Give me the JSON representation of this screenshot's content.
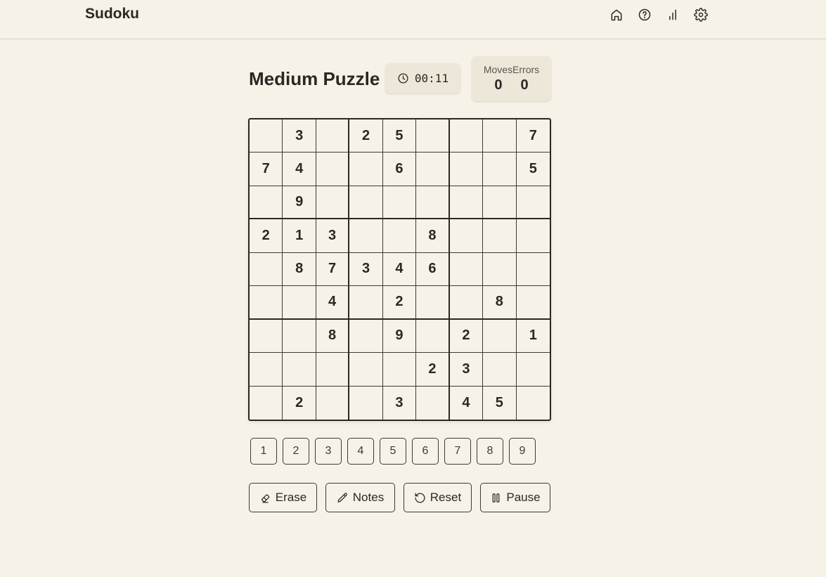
{
  "app": {
    "title": "Sudoku"
  },
  "nav": {
    "icons": [
      "home-icon",
      "help-icon",
      "stats-icon",
      "settings-icon"
    ]
  },
  "puzzle": {
    "title": "Medium Puzzle",
    "timer": "00:11",
    "moves_label": "Moves",
    "errors_label": "Errors",
    "moves": "0",
    "errors": "0"
  },
  "board": [
    [
      "",
      "3",
      "",
      "2",
      "5",
      "",
      "",
      "",
      "7"
    ],
    [
      "7",
      "4",
      "",
      "",
      "6",
      "",
      "",
      "",
      "5"
    ],
    [
      "",
      "9",
      "",
      "",
      "",
      "",
      "",
      "",
      ""
    ],
    [
      "2",
      "1",
      "3",
      "",
      "",
      "8",
      "",
      "",
      ""
    ],
    [
      "",
      "8",
      "7",
      "3",
      "4",
      "6",
      "",
      "",
      ""
    ],
    [
      "",
      "",
      "4",
      "",
      "2",
      "",
      "",
      "8",
      ""
    ],
    [
      "",
      "",
      "8",
      "",
      "9",
      "",
      "2",
      "",
      "1"
    ],
    [
      "",
      "",
      "",
      "",
      "",
      "2",
      "3",
      "",
      ""
    ],
    [
      "",
      "2",
      "",
      "",
      "3",
      "",
      "4",
      "5",
      ""
    ]
  ],
  "numpad": [
    "1",
    "2",
    "3",
    "4",
    "5",
    "6",
    "7",
    "8",
    "9"
  ],
  "actions": {
    "erase": "Erase",
    "notes": "Notes",
    "reset": "Reset",
    "pause": "Pause"
  },
  "colors": {
    "background": "#f6f2e8",
    "panel": "#ede7d9",
    "text": "#2b2823"
  }
}
